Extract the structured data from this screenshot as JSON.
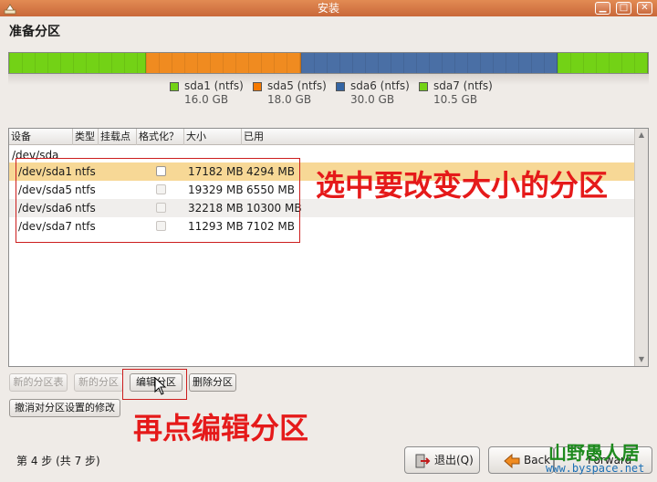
{
  "window": {
    "title": "安装"
  },
  "page": {
    "title": "准备分区"
  },
  "partitions_bar": [
    {
      "name": "sda1",
      "flex": 16.0,
      "color": "#73d216"
    },
    {
      "name": "sda5",
      "flex": 18.0,
      "color": "#f08b20"
    },
    {
      "name": "sda6",
      "flex": 30.0,
      "color": "#4a6fa5"
    },
    {
      "name": "sda7",
      "flex": 10.5,
      "color": "#73d216"
    }
  ],
  "legend": [
    {
      "label": "sda1 (ntfs)",
      "size": "16.0 GB",
      "color": "#73d216"
    },
    {
      "label": "sda5 (ntfs)",
      "size": "18.0 GB",
      "color": "#f57900"
    },
    {
      "label": "sda6 (ntfs)",
      "size": "30.0 GB",
      "color": "#3465a4"
    },
    {
      "label": "sda7 (ntfs)",
      "size": "10.5 GB",
      "color": "#73d216"
    }
  ],
  "table": {
    "headers": [
      "设备",
      "类型",
      "挂载点",
      "格式化？",
      "大小",
      "已用"
    ],
    "disk": "/dev/sda",
    "rows": [
      {
        "device": "/dev/sda1",
        "type": "ntfs",
        "size": "17182 MB",
        "used": "4294 MB"
      },
      {
        "device": "/dev/sda5",
        "type": "ntfs",
        "size": "19329 MB",
        "used": "6550 MB"
      },
      {
        "device": "/dev/sda6",
        "type": "ntfs",
        "size": "32218 MB",
        "used": "10300 MB"
      },
      {
        "device": "/dev/sda7",
        "type": "ntfs",
        "size": "11293 MB",
        "used": "7102 MB"
      }
    ]
  },
  "annotations": {
    "select": "选中要改变大小的分区",
    "edit": "再点编辑分区"
  },
  "buttons": {
    "new_table": "新的分区表",
    "new_partition": "新的分区",
    "edit_partition": "编辑分区",
    "delete_partition": "删除分区",
    "undo": "撤消对分区设置的修改",
    "quit": "退出(Q)",
    "back": "Back",
    "forward": "Forward"
  },
  "footer": {
    "step": "第 4 步 (共 7 步)"
  },
  "watermark": {
    "site_name": "山野愚人居",
    "url": "www.byspace.net"
  }
}
